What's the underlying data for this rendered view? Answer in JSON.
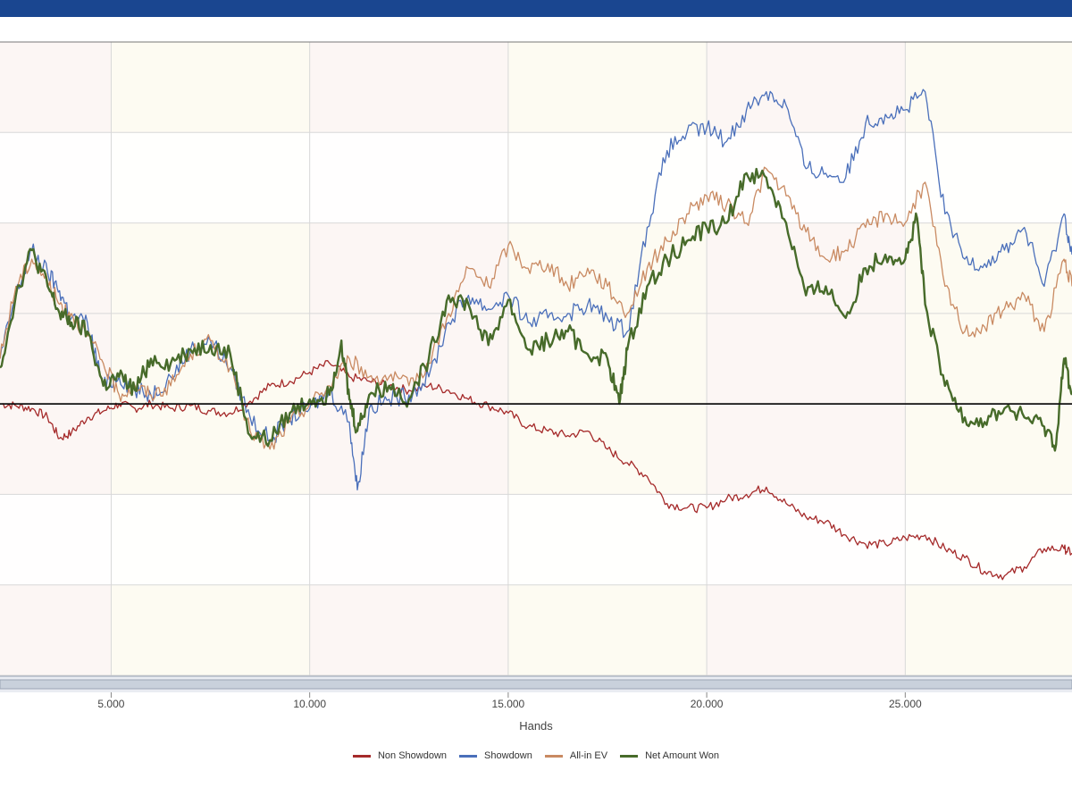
{
  "colors": {
    "header": "#1a4690",
    "band_a": "#fcf6f4",
    "band_b": "#fdfbf2",
    "band_white": "#ffffff",
    "grid": "#d8d8d8",
    "zero_line": "#111111",
    "non_showdown": "#a52a2a",
    "showdown": "#4a6fba",
    "all_in_ev": "#c98a62",
    "net_won": "#476b2a"
  },
  "chart_data": {
    "type": "line",
    "xlabel": "Hands",
    "ylabel": "",
    "title": "",
    "xlim": [
      2200,
      29200
    ],
    "ylim": [
      -3,
      4
    ],
    "x_ticks": [
      5000,
      10000,
      15000,
      20000,
      25000
    ],
    "x_tick_labels": [
      "5.000",
      "10.000",
      "15.000",
      "20.000",
      "25.000"
    ],
    "grid": true,
    "legend_position": "bottom",
    "series": [
      {
        "name": "Non Showdown",
        "x": [
          2200,
          2600,
          3000,
          3400,
          3700,
          4000,
          4400,
          4800,
          5200,
          5600,
          6000,
          6500,
          7000,
          7500,
          8000,
          8500,
          9000,
          9500,
          10000,
          10500,
          11000,
          11500,
          12000,
          12500,
          13000,
          13500,
          14000,
          14500,
          15000,
          15500,
          16000,
          16500,
          17000,
          17500,
          18000,
          18500,
          19000,
          19500,
          20000,
          20500,
          21000,
          21500,
          22000,
          22500,
          23000,
          23500,
          24000,
          24500,
          25000,
          25500,
          26000,
          26500,
          27000,
          27500,
          28000,
          28500,
          29000,
          29200
        ],
        "y": [
          0.0,
          -0.02,
          -0.05,
          -0.15,
          -0.38,
          -0.32,
          -0.15,
          -0.08,
          0.0,
          -0.05,
          0.0,
          -0.05,
          -0.02,
          -0.08,
          -0.1,
          0.03,
          0.2,
          0.25,
          0.35,
          0.45,
          0.3,
          0.25,
          0.2,
          0.15,
          0.2,
          0.15,
          0.05,
          -0.02,
          -0.1,
          -0.25,
          -0.3,
          -0.35,
          -0.3,
          -0.5,
          -0.65,
          -0.8,
          -1.1,
          -1.15,
          -1.15,
          -1.05,
          -1.0,
          -0.92,
          -1.1,
          -1.25,
          -1.3,
          -1.45,
          -1.55,
          -1.55,
          -1.48,
          -1.45,
          -1.6,
          -1.7,
          -1.85,
          -1.9,
          -1.8,
          -1.6,
          -1.6,
          -1.65
        ]
      },
      {
        "name": "Showdown",
        "x": [
          2200,
          2600,
          3000,
          3400,
          3700,
          4000,
          4400,
          4800,
          5200,
          5600,
          6000,
          6500,
          7000,
          7500,
          8000,
          8500,
          9000,
          9500,
          10000,
          10500,
          11000,
          11200,
          11500,
          12000,
          12500,
          13000,
          13500,
          14000,
          14500,
          15000,
          15500,
          16000,
          16500,
          17000,
          17500,
          18000,
          18500,
          19000,
          19500,
          20000,
          20500,
          21000,
          21500,
          22000,
          22500,
          23000,
          23500,
          24000,
          24500,
          25000,
          25500,
          26000,
          26500,
          27000,
          27500,
          28000,
          28500,
          29000,
          29200
        ],
        "y": [
          0.5,
          1.2,
          1.7,
          1.45,
          1.25,
          0.95,
          0.9,
          0.2,
          0.3,
          0.15,
          0.1,
          0.3,
          0.6,
          0.7,
          0.4,
          -0.15,
          -0.4,
          -0.15,
          -0.05,
          0.15,
          -0.2,
          -0.95,
          -0.05,
          0.05,
          0.1,
          0.3,
          0.9,
          1.2,
          1.05,
          1.2,
          0.9,
          0.95,
          1.0,
          1.1,
          0.95,
          0.8,
          1.95,
          2.8,
          3.0,
          3.05,
          2.9,
          3.25,
          3.45,
          3.3,
          2.6,
          2.55,
          2.5,
          3.1,
          3.2,
          3.25,
          3.45,
          2.1,
          1.6,
          1.55,
          1.7,
          1.95,
          1.3,
          2.1,
          1.65
        ]
      },
      {
        "name": "All-in EV",
        "x": [
          2200,
          2600,
          3000,
          3400,
          3700,
          4000,
          4400,
          4800,
          5200,
          5600,
          6000,
          6500,
          7000,
          7500,
          8000,
          8500,
          9000,
          9500,
          10000,
          10500,
          11000,
          11500,
          12000,
          12500,
          13000,
          13500,
          14000,
          14500,
          15000,
          15500,
          16000,
          16500,
          17000,
          17500,
          18000,
          18500,
          19000,
          19500,
          20000,
          20500,
          21000,
          21500,
          22000,
          22500,
          23000,
          23500,
          24000,
          24500,
          25000,
          25500,
          26000,
          26500,
          27000,
          27500,
          28000,
          28500,
          29000,
          29200
        ],
        "y": [
          0.5,
          1.3,
          1.6,
          1.35,
          1.1,
          1.0,
          0.75,
          0.45,
          0.1,
          0.2,
          0.1,
          0.2,
          0.55,
          0.7,
          0.4,
          -0.3,
          -0.5,
          -0.2,
          0.0,
          0.2,
          0.5,
          0.3,
          0.3,
          0.2,
          0.45,
          1.0,
          1.5,
          1.3,
          1.75,
          1.5,
          1.55,
          1.3,
          1.5,
          1.3,
          1.0,
          1.5,
          1.8,
          2.1,
          2.3,
          2.2,
          2.0,
          2.6,
          2.3,
          1.9,
          1.6,
          1.7,
          1.95,
          2.1,
          2.0,
          2.45,
          1.3,
          0.8,
          0.85,
          1.05,
          1.2,
          0.8,
          1.6,
          1.3
        ]
      },
      {
        "name": "Net Amount Won",
        "x": [
          2200,
          2600,
          3000,
          3400,
          3700,
          4000,
          4400,
          4800,
          5200,
          5600,
          6000,
          6500,
          7000,
          7500,
          8000,
          8500,
          9000,
          9500,
          10000,
          10500,
          10800,
          11000,
          11200,
          11500,
          12000,
          12500,
          13000,
          13500,
          14000,
          14500,
          15000,
          15500,
          16000,
          16500,
          17000,
          17500,
          17800,
          18000,
          18500,
          19000,
          19500,
          20000,
          20500,
          21000,
          21500,
          22000,
          22500,
          23000,
          23500,
          24000,
          24500,
          25000,
          25300,
          25500,
          26000,
          26500,
          27000,
          27500,
          28000,
          28500,
          28800,
          29000,
          29200
        ],
        "y": [
          0.4,
          1.2,
          1.7,
          1.3,
          1.0,
          0.9,
          0.8,
          0.2,
          0.3,
          0.15,
          0.5,
          0.45,
          0.6,
          0.65,
          0.55,
          -0.35,
          -0.4,
          -0.1,
          0.05,
          0.1,
          0.7,
          0.05,
          -0.3,
          0.1,
          0.2,
          0.05,
          0.5,
          1.2,
          1.1,
          0.65,
          1.15,
          0.6,
          0.7,
          0.8,
          0.55,
          0.5,
          0.0,
          0.6,
          1.3,
          1.6,
          1.8,
          1.95,
          2.0,
          2.55,
          2.5,
          2.0,
          1.2,
          1.3,
          0.95,
          1.5,
          1.65,
          1.6,
          2.05,
          1.1,
          0.2,
          -0.15,
          -0.2,
          -0.05,
          -0.15,
          -0.25,
          -0.45,
          0.5,
          0.1
        ]
      }
    ]
  }
}
